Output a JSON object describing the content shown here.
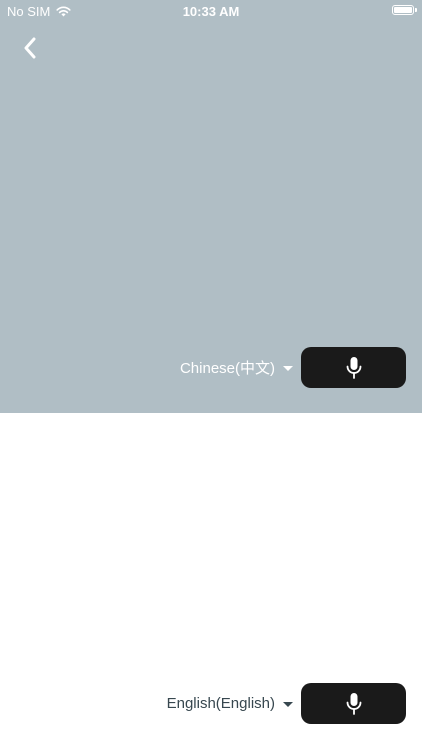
{
  "status_bar": {
    "carrier": "No SIM",
    "time": "10:33 AM",
    "icons": [
      "wifi-icon",
      "battery-icon"
    ]
  },
  "colors": {
    "top_panel_bg": "#b0bec5",
    "bottom_panel_bg": "#ffffff",
    "mic_button_bg": "#1a1a1a",
    "top_text": "#ffffff",
    "bottom_text": "#37474f"
  },
  "top_panel": {
    "back_icon": "chevron-left-icon",
    "language": "Chinese(中文)",
    "mic_icon": "microphone-icon"
  },
  "bottom_panel": {
    "language": "English(English)",
    "mic_icon": "microphone-icon"
  }
}
